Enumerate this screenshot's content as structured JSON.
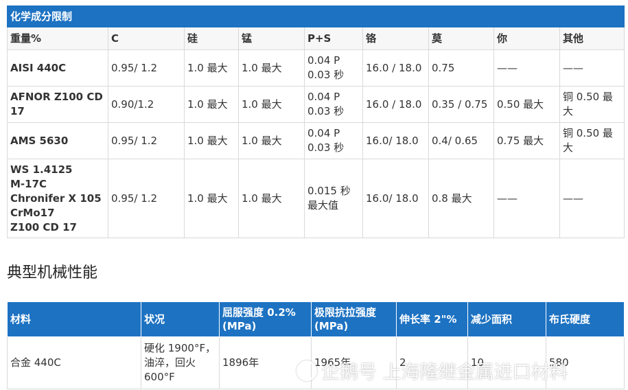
{
  "composition": {
    "caption": "化学成分限制",
    "headers": [
      "重量%",
      "C",
      "硅",
      "锰",
      "P+S",
      "铬",
      "莫",
      "你",
      "其他"
    ],
    "rows": [
      {
        "grade": [
          "AISI 440C"
        ],
        "c": "0.95/ 1.2",
        "si": "1.0 最大",
        "mn": "1.0 最大",
        "ps": [
          "0.04 P",
          "0.03 秒"
        ],
        "cr": "16.0 / 18.0",
        "mo": "0.75",
        "ni": "——",
        "other": "——"
      },
      {
        "grade": [
          "AFNOR Z100 CD",
          "17"
        ],
        "c": "0.90/1.2",
        "si": "1.0 最大",
        "mn": "1.0 最大",
        "ps": [
          "0.04 P",
          "0.03 秒"
        ],
        "cr": "16.0 / 18.0",
        "mo": "0.35 / 0.75",
        "ni": "0.50 最大",
        "other": "铜 0.50 最大"
      },
      {
        "grade": [
          "AMS 5630"
        ],
        "c": "0.95/ 1.2",
        "si": "1.0 最大",
        "mn": "1.0 最大",
        "ps": [
          "0.04 P",
          "0.03 秒"
        ],
        "cr": "16.0/ 18.0",
        "mo": "0.4/ 0.65",
        "ni": "0.75 最大",
        "other": "铜 0.50 最大"
      },
      {
        "grade": [
          "WS 1.4125",
          "M-17C",
          "Chronifer X 105",
          "CrMo17",
          "Z100 CD 17"
        ],
        "c": "0.95/ 1.2",
        "si": "1.0 最大",
        "mn": "1.0 最大",
        "ps": [
          "0.015 秒",
          "最大值"
        ],
        "cr": "16.0/ 18.0",
        "mo": "0.8 最大",
        "ni": "——",
        "other": "——"
      }
    ]
  },
  "section_title": "典型机械性能",
  "mechanical": {
    "headers": [
      "材料",
      "状况",
      "屈服强度 0.2% (MPa)",
      "极限抗拉强度 (MPa)",
      "伸长率 2\"%",
      "减少面积",
      "布氏硬度"
    ],
    "rows": [
      {
        "material": "合金 440C",
        "condition": "硬化 1900°F，油淬，回火 600°F",
        "yield": "1896年",
        "uts": "1965年",
        "elong": "2",
        "reduction": "10",
        "hardness": "580"
      }
    ]
  },
  "watermark": "企鹅号 上海隆继金属进口材料"
}
